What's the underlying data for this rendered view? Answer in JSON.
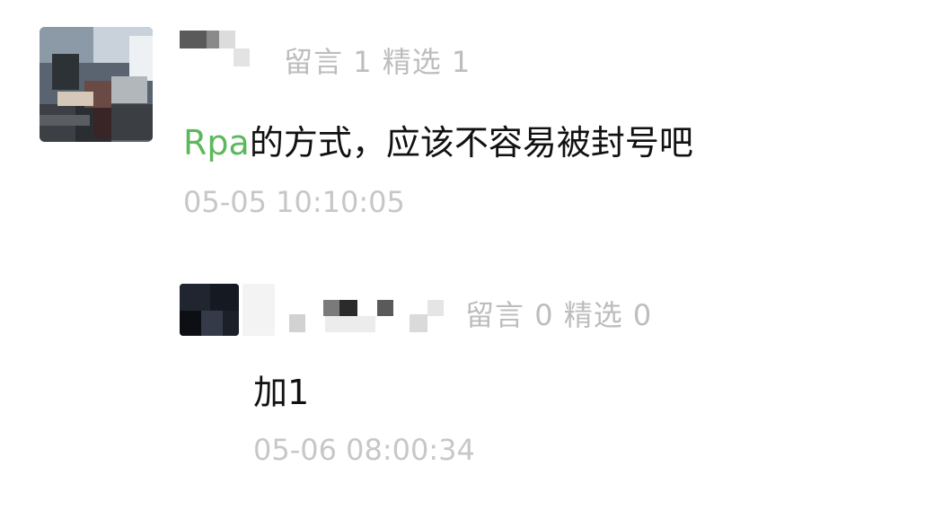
{
  "comments": [
    {
      "stats": {
        "label_msg": "留言",
        "msg_count": "1",
        "label_pick": "精选",
        "pick_count": "1"
      },
      "content_highlight": "Rpa",
      "content_rest": "的方式，应该不容易被封号吧",
      "time": "05-05 10:10:05"
    },
    {
      "stats": {
        "label_msg": "留言",
        "msg_count": "0",
        "label_pick": "精选",
        "pick_count": "0"
      },
      "content": "加1",
      "time": "05-06 08:00:34"
    }
  ],
  "colors": {
    "highlight": "#5cb85c",
    "stats": "#bdbdbd",
    "time": "#c7c7c7"
  }
}
